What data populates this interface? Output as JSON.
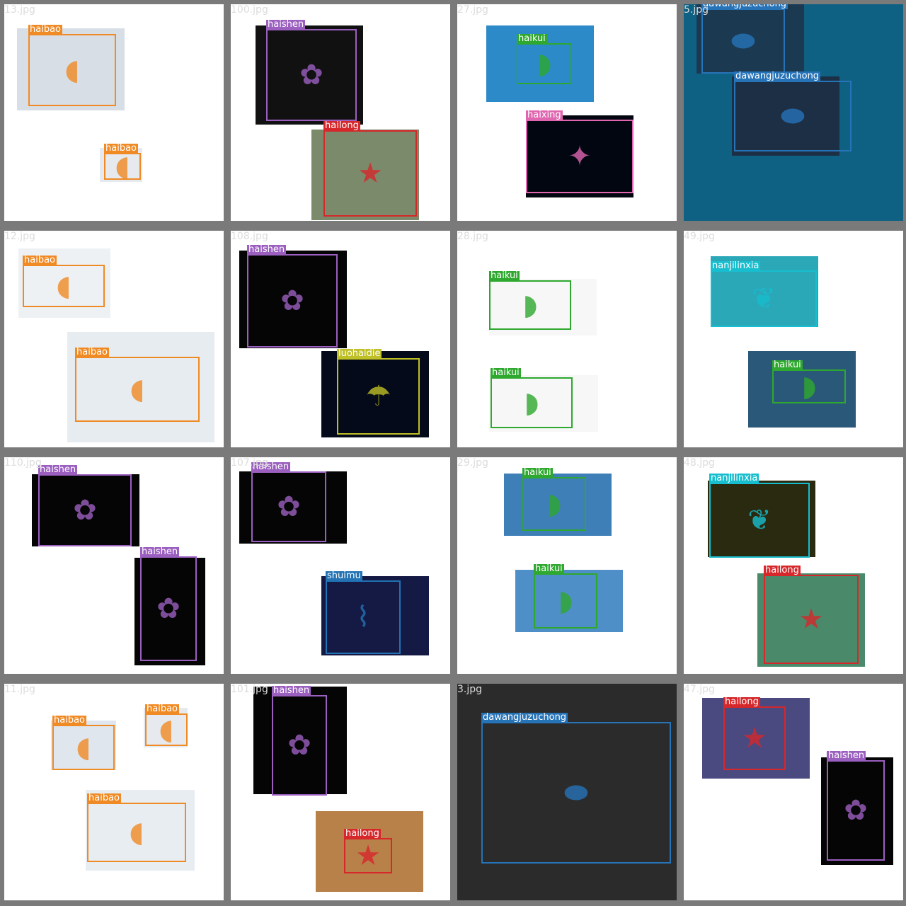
{
  "colors": {
    "haibao": "#f08a24",
    "haishen": "#9b5fc0",
    "hailong": "#d6272b",
    "haikui": "#2ea82e",
    "haixing": "#e066b0",
    "dawangjuzuchong": "#2673b8",
    "luohaidie": "#bfbf26",
    "nanjilinxia": "#17becf",
    "shuimu": "#2272b4"
  },
  "tiles": [
    {
      "file": "13.jpg",
      "boxes": [
        {
          "label": "haibao"
        },
        {
          "label": "haibao"
        }
      ]
    },
    {
      "file": "100.jpg",
      "boxes": [
        {
          "label": "haishen"
        },
        {
          "label": "hailong"
        }
      ]
    },
    {
      "file": "27.jpg",
      "boxes": [
        {
          "label": "haikui"
        },
        {
          "label": "haixing"
        }
      ]
    },
    {
      "file": "5.jpg",
      "boxes": [
        {
          "label": "dawangjuzuchong"
        },
        {
          "label": "dawangjuzuchong"
        }
      ]
    },
    {
      "file": "12.jpg",
      "boxes": [
        {
          "label": "haibao"
        },
        {
          "label": "haibao"
        }
      ]
    },
    {
      "file": "108.jpg",
      "boxes": [
        {
          "label": "haishen"
        },
        {
          "label": "luohaidie"
        }
      ]
    },
    {
      "file": "28.jpg",
      "boxes": [
        {
          "label": "haikui"
        },
        {
          "label": "haikui"
        }
      ]
    },
    {
      "file": "49.jpg",
      "boxes": [
        {
          "label": "nanjilinxia"
        },
        {
          "label": "haikui"
        }
      ]
    },
    {
      "file": "110.jpg",
      "boxes": [
        {
          "label": "haishen"
        },
        {
          "label": "haishen"
        }
      ]
    },
    {
      "file": "107.jpg",
      "boxes": [
        {
          "label": "haishen"
        },
        {
          "label": "shuimu"
        }
      ]
    },
    {
      "file": "29.jpg",
      "boxes": [
        {
          "label": "haikui"
        },
        {
          "label": "haikui"
        }
      ]
    },
    {
      "file": "48.jpg",
      "boxes": [
        {
          "label": "nanjilinxia"
        },
        {
          "label": "hailong"
        }
      ]
    },
    {
      "file": "11.jpg",
      "boxes": [
        {
          "label": "haibao"
        },
        {
          "label": "haibao"
        },
        {
          "label": "haibao"
        }
      ]
    },
    {
      "file": "101.jpg",
      "boxes": [
        {
          "label": "haishen"
        },
        {
          "label": "hailong"
        }
      ]
    },
    {
      "file": "3.jpg",
      "boxes": [
        {
          "label": "dawangjuzuchong"
        }
      ]
    },
    {
      "file": "47.jpg",
      "boxes": [
        {
          "label": "hailong"
        },
        {
          "label": "haishen"
        }
      ]
    }
  ]
}
